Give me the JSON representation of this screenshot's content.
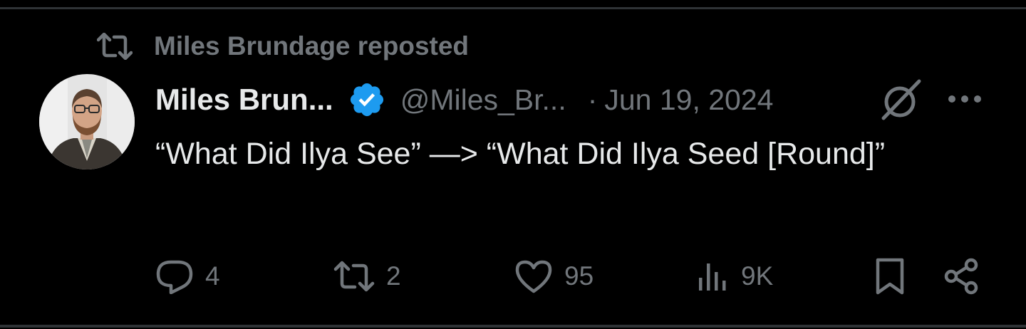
{
  "repost": {
    "label": "Miles Brundage reposted",
    "icon": "repost-icon"
  },
  "tweet": {
    "display_name": "Miles Brun...",
    "verified_icon": "verified-badge-icon",
    "handle": "@Miles_Br...",
    "separator": "·",
    "date": "Jun 19, 2024",
    "text": "“What Did Ilya See” —> “What Did Ilya Seed [Round]”",
    "grok_icon": "grok-icon",
    "more_icon": "more-options-icon"
  },
  "actions": {
    "reply_count": "4",
    "repost_count": "2",
    "like_count": "95",
    "views_count": "9K"
  },
  "colors": {
    "background": "#000000",
    "text_primary": "#e7e9ea",
    "text_secondary": "#71767b",
    "verified_blue": "#1d9bf0",
    "divider": "#2f3336"
  }
}
